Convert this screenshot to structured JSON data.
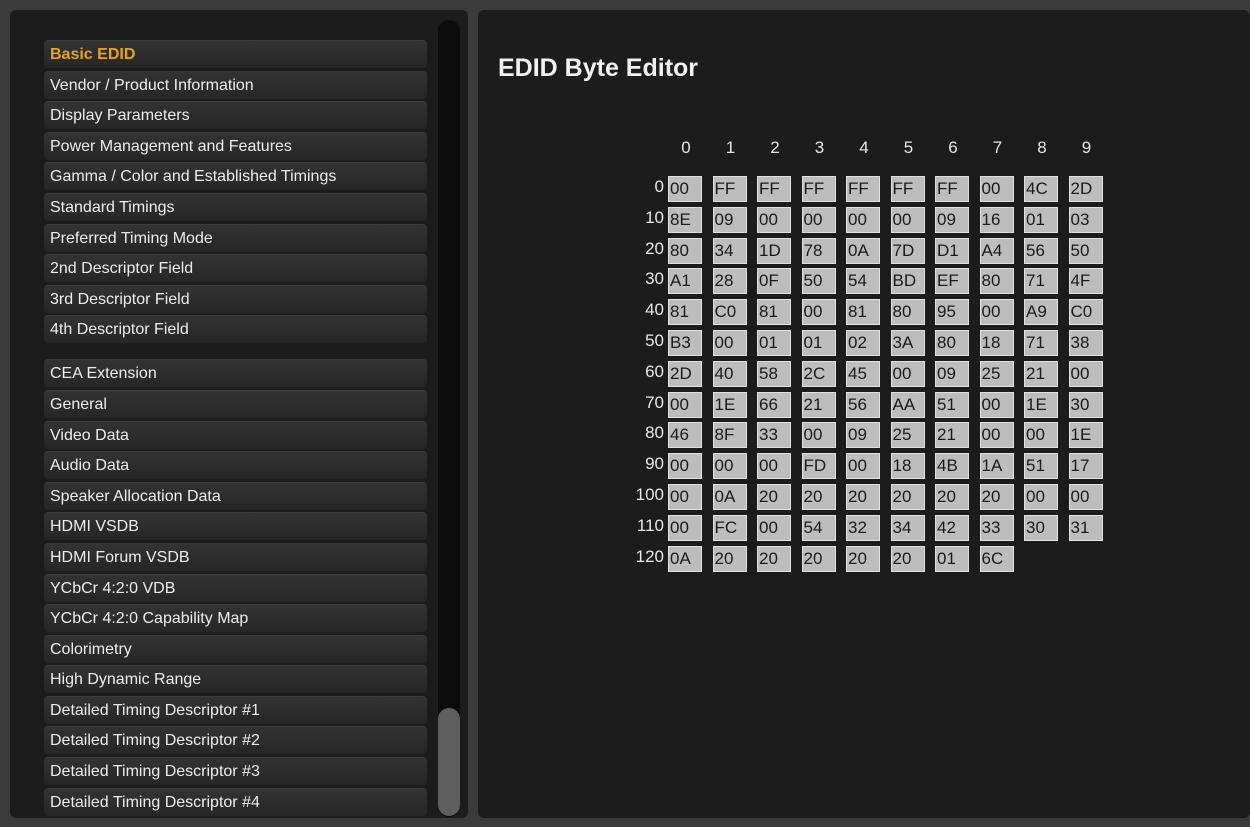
{
  "sidebar": {
    "basic_group": [
      "Basic EDID",
      "Vendor / Product Information",
      "Display Parameters",
      "Power Management and Features",
      "Gamma / Color and Established Timings",
      "Standard Timings",
      "Preferred Timing Mode",
      "2nd Descriptor Field",
      "3rd Descriptor Field",
      "4th Descriptor Field"
    ],
    "cea_group": [
      "CEA Extension",
      "General",
      "Video Data",
      "Audio Data",
      "Speaker Allocation Data",
      "HDMI VSDB",
      "HDMI Forum VSDB",
      "YCbCr 4:2:0 VDB",
      "YCbCr 4:2:0 Capability Map",
      "Colorimetry",
      "High Dynamic Range",
      "Detailed Timing Descriptor #1",
      "Detailed Timing Descriptor #2",
      "Detailed Timing Descriptor #3",
      "Detailed Timing Descriptor #4"
    ],
    "active_item": "Basic EDID",
    "colors": {
      "active_text": "#e6a21a",
      "item_text": "#eeeeee"
    }
  },
  "editor": {
    "title": "EDID Byte Editor",
    "column_labels": [
      "0",
      "1",
      "2",
      "3",
      "4",
      "5",
      "6",
      "7",
      "8",
      "9"
    ],
    "row_labels": [
      "0",
      "10",
      "20",
      "30",
      "40",
      "50",
      "60",
      "70",
      "80",
      "90",
      "100",
      "110",
      "120"
    ],
    "bytes": [
      [
        "00",
        "FF",
        "FF",
        "FF",
        "FF",
        "FF",
        "FF",
        "00",
        "4C",
        "2D"
      ],
      [
        "8E",
        "09",
        "00",
        "00",
        "00",
        "00",
        "09",
        "16",
        "01",
        "03"
      ],
      [
        "80",
        "34",
        "1D",
        "78",
        "0A",
        "7D",
        "D1",
        "A4",
        "56",
        "50"
      ],
      [
        "A1",
        "28",
        "0F",
        "50",
        "54",
        "BD",
        "EF",
        "80",
        "71",
        "4F"
      ],
      [
        "81",
        "C0",
        "81",
        "00",
        "81",
        "80",
        "95",
        "00",
        "A9",
        "C0"
      ],
      [
        "B3",
        "00",
        "01",
        "01",
        "02",
        "3A",
        "80",
        "18",
        "71",
        "38"
      ],
      [
        "2D",
        "40",
        "58",
        "2C",
        "45",
        "00",
        "09",
        "25",
        "21",
        "00"
      ],
      [
        "00",
        "1E",
        "66",
        "21",
        "56",
        "AA",
        "51",
        "00",
        "1E",
        "30"
      ],
      [
        "46",
        "8F",
        "33",
        "00",
        "09",
        "25",
        "21",
        "00",
        "00",
        "1E"
      ],
      [
        "00",
        "00",
        "00",
        "FD",
        "00",
        "18",
        "4B",
        "1A",
        "51",
        "17"
      ],
      [
        "00",
        "0A",
        "20",
        "20",
        "20",
        "20",
        "20",
        "20",
        "00",
        "00"
      ],
      [
        "00",
        "FC",
        "00",
        "54",
        "32",
        "34",
        "42",
        "33",
        "30",
        "31"
      ],
      [
        "0A",
        "20",
        "20",
        "20",
        "20",
        "20",
        "01",
        "6C"
      ]
    ],
    "colors": {
      "cell_bg": "#bdbdbd",
      "cell_text": "#1a1a1a",
      "label_text": "#e8e8e8"
    }
  }
}
